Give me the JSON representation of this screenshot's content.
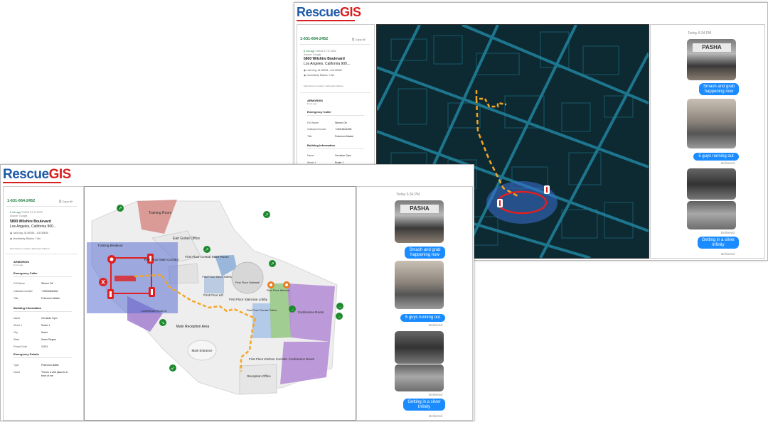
{
  "app": {
    "logo_rescue": "Rescue",
    "logo_gis": "GIS"
  },
  "caller": {
    "phone": "1-631-664-2452",
    "copy_label": "Copy All",
    "age": "8 min ago",
    "time_detail": "T-MOD 07:17:2022",
    "source": "Source: Google",
    "address_line1": "5800 Wilshire Boulevard",
    "address_line2": "Los Angeles, California 900...",
    "latlong": "Lat/Long: 34.06208, -118.35635",
    "radius": "Uncertainty Radius: 7.8m",
    "footnote": "Most Recent Location, Estimated Address"
  },
  "armorgis": {
    "title": "ARMORGIS",
    "age": "8 min ago"
  },
  "emergency_caller": {
    "heading": "Emergency Caller",
    "rows": [
      {
        "label": "Full Name",
        "value": "Steven Ott"
      },
      {
        "label": "Callback Number",
        "value": "+16316642452"
      },
      {
        "label": "Title",
        "value": "Pokemon Master"
      }
    ]
  },
  "building": {
    "heading": "Building Information",
    "rows": [
      {
        "label": "Name",
        "value": "Cerulean Gym"
      },
      {
        "label": "Street 1",
        "value": "Route 1"
      },
      {
        "label": "City",
        "value": "Kanto"
      },
      {
        "label": "State",
        "value": "Kanto Region"
      },
      {
        "label": "Postal Code",
        "value": "11101"
      }
    ]
  },
  "emergency_details": {
    "heading": "Emergency Details",
    "rows": [
      {
        "label": "Type",
        "value": "Pokemon Battle"
      },
      {
        "label": "Notes",
        "value": "Theres a wild pikachu in front of me"
      }
    ]
  },
  "chat": {
    "timestamp": "Today 6:34 PM",
    "messages": [
      "Smash and grab happening now",
      "5 guys running out",
      "Getting in a silver Infinity"
    ],
    "delivered": "Delivered"
  },
  "floorplan": {
    "rooms": {
      "training_room": "Training Room",
      "earl_gobel": "Earl Gobel Office",
      "training_breakout": "Training Breakout",
      "first_floor_main_corridor": "First Floor Main Corridor",
      "first_floor_central_store": "First Floor Central Store Room",
      "first_floor_mens_toilets": "First Floor Mens Toilets",
      "first_floor_lift": "First Floor Lift",
      "first_floor_stairwell": "First Floor Stairwell",
      "first_floor_staircase_lobby": "First Floor Staircase Lobby",
      "first_floor_kitchen": "First Floor Kitchen",
      "conference_room_a": "Conference Room",
      "conference_room_b": "Conference Room",
      "female_toilets": "First Floor Female Toilets",
      "first_floor_kitchen_corridor": "First Floor Kitchen Corridor",
      "main_reception_area": "Main Reception Area",
      "main_entrance": "Main Entrance",
      "reception_office": "Reception Office",
      "conference_room_a_small": "Conference Room A"
    }
  },
  "colors": {
    "accent": "#1a8cff",
    "brand_blue": "#1f5aa8",
    "brand_red": "#d81f1f",
    "route": "#f5a623",
    "map_bg": "#0d2a33",
    "map_street": "#1d6f86"
  }
}
